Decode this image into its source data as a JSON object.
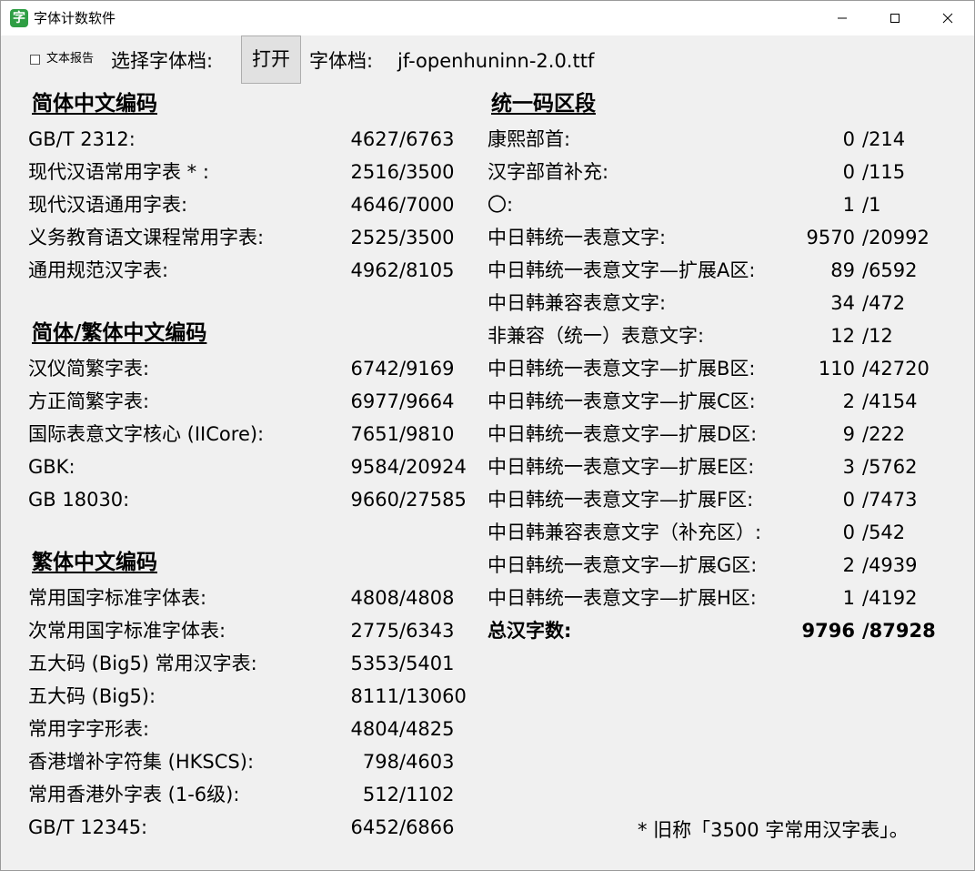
{
  "window": {
    "title": "字体计数软件",
    "app_icon_glyph": "字"
  },
  "toolbar": {
    "report_checkbox_label": "文本报告",
    "report_checked": false,
    "select_label": "选择字体档:",
    "open_button": "打开",
    "font_label": "字体档:",
    "font_file": "jf-openhuninn-2.0.ttf"
  },
  "sections": {
    "simplified": {
      "title": "简体中文编码",
      "rows": [
        {
          "label": "GB/T 2312:",
          "count": "4627",
          "total": "/6763"
        },
        {
          "label": "现代汉语常用字表 * :",
          "count": "2516",
          "total": "/3500"
        },
        {
          "label": "现代汉语通用字表:",
          "count": "4646",
          "total": "/7000"
        },
        {
          "label": "义务教育语文课程常用字表:",
          "count": "2525",
          "total": "/3500"
        },
        {
          "label": "通用规范汉字表:",
          "count": "4962",
          "total": "/8105"
        }
      ]
    },
    "mixed": {
      "title": "简体/繁体中文编码",
      "rows": [
        {
          "label": "汉仪简繁字表:",
          "count": "6742",
          "total": "/9169"
        },
        {
          "label": "方正简繁字表:",
          "count": "6977",
          "total": "/9664"
        },
        {
          "label": "国际表意文字核心 (IICore):",
          "count": "7651",
          "total": "/9810"
        },
        {
          "label": "GBK:",
          "count": "9584",
          "total": "/20924"
        },
        {
          "label": "GB 18030:",
          "count": "9660",
          "total": "/27585"
        }
      ]
    },
    "traditional": {
      "title": "繁体中文编码",
      "rows": [
        {
          "label": "常用国字标准字体表:",
          "count": "4808",
          "total": "/4808"
        },
        {
          "label": "次常用国字标准字体表:",
          "count": "2775",
          "total": "/6343"
        },
        {
          "label": "五大码 (Big5) 常用汉字表:",
          "count": "5353",
          "total": "/5401"
        },
        {
          "label": "五大码 (Big5):",
          "count": "8111",
          "total": "/13060"
        },
        {
          "label": "常用字字形表:",
          "count": "4804",
          "total": "/4825"
        },
        {
          "label": "香港增补字符集 (HKSCS):",
          "count": "798",
          "total": "/4603"
        },
        {
          "label": "常用香港外字表 (1-6级):",
          "count": "512",
          "total": "/1102"
        },
        {
          "label": "GB/T 12345:",
          "count": "6452",
          "total": "/6866"
        }
      ]
    },
    "unicode": {
      "title": "统一码区段",
      "rows": [
        {
          "label": "康熙部首:",
          "count": "0",
          "total": "/214"
        },
        {
          "label": "汉字部首补充:",
          "count": "0",
          "total": "/115"
        },
        {
          "label": "〇:",
          "count": "1",
          "total": "/1"
        },
        {
          "label": "中日韩统一表意文字:",
          "count": "9570",
          "total": "/20992"
        },
        {
          "label": "中日韩统一表意文字—扩展A区:",
          "count": "89",
          "total": "/6592"
        },
        {
          "label": "中日韩兼容表意文字:",
          "count": "34",
          "total": "/472"
        },
        {
          "label": "   非兼容（统一）表意文字:",
          "count": "12",
          "total": "/12"
        },
        {
          "label": "中日韩统一表意文字—扩展B区:",
          "count": "110",
          "total": "/42720"
        },
        {
          "label": "中日韩统一表意文字—扩展C区:",
          "count": "2",
          "total": "/4154"
        },
        {
          "label": "中日韩统一表意文字—扩展D区:",
          "count": "9",
          "total": "/222"
        },
        {
          "label": "中日韩统一表意文字—扩展E区:",
          "count": "3",
          "total": "/5762"
        },
        {
          "label": "中日韩统一表意文字—扩展F区:",
          "count": "0",
          "total": "/7473"
        },
        {
          "label": "中日韩兼容表意文字（补充区）:",
          "count": "0",
          "total": "/542"
        },
        {
          "label": "中日韩统一表意文字—扩展G区:",
          "count": "2",
          "total": "/4939"
        },
        {
          "label": "中日韩统一表意文字—扩展H区:",
          "count": "1",
          "total": "/4192"
        }
      ],
      "grand_total": {
        "label": "总汉字数:",
        "count": "9796",
        "total": "/87928"
      }
    }
  },
  "footnote": "* 旧称「3500 字常用汉字表」。"
}
